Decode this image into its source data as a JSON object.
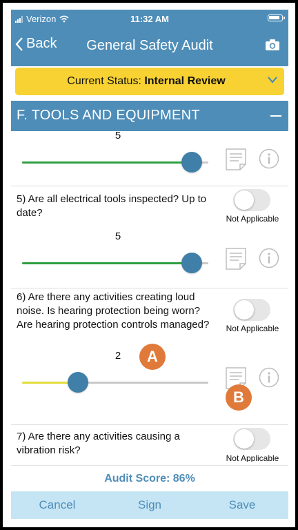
{
  "statusbar": {
    "carrier": "Verizon",
    "time": "11:32 AM"
  },
  "nav": {
    "back_label": "Back",
    "title": "General Safety Audit"
  },
  "status": {
    "label": "Current Status: ",
    "value": "Internal Review"
  },
  "section": {
    "title": "F. TOOLS AND EQUIPMENT"
  },
  "questions": [
    {
      "text": "",
      "value": "5",
      "fraction": 0.91,
      "color": "#2e9e3f"
    },
    {
      "text": "5) Are all electrical tools inspected? Up to date?",
      "value": "5",
      "fraction": 0.91,
      "color": "#2e9e3f",
      "na_label": "Not Applicable"
    },
    {
      "text": "6) Are there any activities creating loud noise. Is hearing protection being worn? Are hearing protection controls managed?",
      "value": "2",
      "fraction": 0.3,
      "color": "#e2dd3a",
      "na_label": "Not Applicable"
    },
    {
      "text": "7) Are there any activities causing a vibration risk?",
      "value": "",
      "na_label": "Not Applicable"
    }
  ],
  "badges": {
    "a": "A",
    "b": "B"
  },
  "score": {
    "text": "Audit Score: 86%"
  },
  "bottombar": {
    "cancel": "Cancel",
    "sign": "Sign",
    "save": "Save"
  },
  "colors": {
    "brand": "#4e8db8",
    "status_bg": "#f7d232",
    "thumb": "#3f7fa8",
    "badge": "#e07a3a"
  }
}
